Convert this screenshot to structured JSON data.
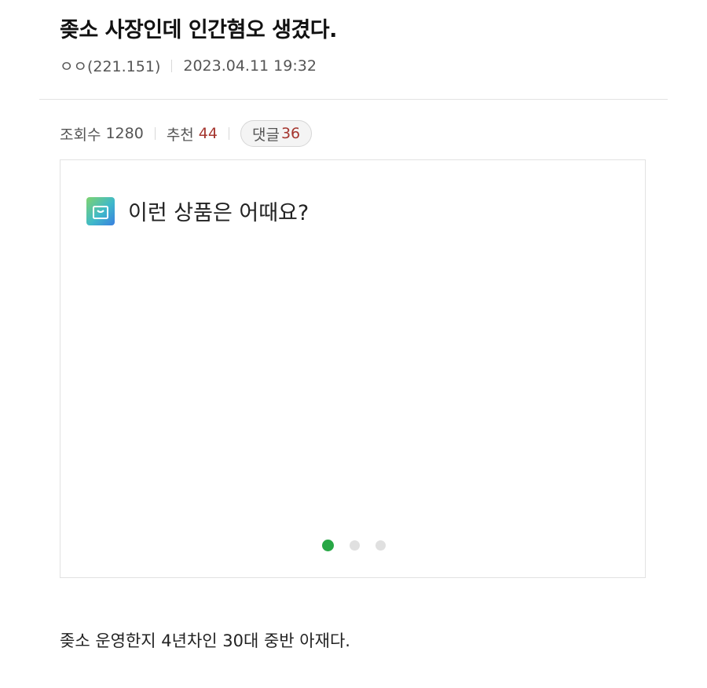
{
  "post": {
    "title": "좆소 사장인데 인간혐오 생겼다.",
    "author": "ㅇㅇ(221.151)",
    "datetime": "2023.04.11 19:32"
  },
  "stats": {
    "views_label": "조회수",
    "views_value": "1280",
    "recommend_label": "추천",
    "recommend_value": "44",
    "comments_label": "댓글",
    "comments_value": "36",
    "count_color": "#a5362f"
  },
  "product_box": {
    "heading": "이런 상품은 어때요?",
    "icon": "shopping-bag-icon",
    "carousel": {
      "page_count": 3,
      "active_index": 0,
      "active_color": "#27a745"
    }
  },
  "body": {
    "first_line": "좆소 운영한지 4년차인 30대 중반 아재다."
  }
}
